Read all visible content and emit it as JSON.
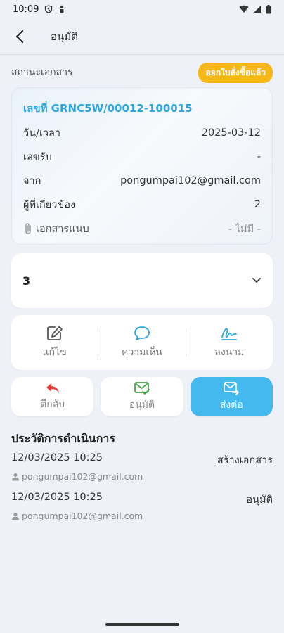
{
  "statusbar": {
    "time": "10:09"
  },
  "appbar": {
    "title": "อนุมัติ"
  },
  "status": {
    "label": "สถานะเอกสาร",
    "badge": "ออกใบสั่งซื้อแล้ว",
    "badge_color": "#f6b814"
  },
  "document": {
    "number": "เลขที่ GRNC5W/00012-100015",
    "rows": [
      {
        "key": "วัน/เวลา",
        "value": "2025-03-12"
      },
      {
        "key": "เลขรับ",
        "value": "-"
      },
      {
        "key": "จาก",
        "value": "pongumpai102@gmail.com"
      },
      {
        "key": "ผู้ที่เกี่ยวข้อง",
        "value": "2"
      }
    ],
    "attachment": {
      "key": "เอกสารแนบ",
      "value": "- ไม่มี -"
    }
  },
  "selector": {
    "value": "3"
  },
  "actions": [
    {
      "label": "แก้ไข",
      "icon": "edit-icon"
    },
    {
      "label": "ความเห็น",
      "icon": "comment-icon"
    },
    {
      "label": "ลงนาม",
      "icon": "signature-icon"
    }
  ],
  "buttons": {
    "reject": {
      "label": "ตีกลับ",
      "icon": "reply-icon",
      "color": "#e53935"
    },
    "approve": {
      "label": "อนุมัติ",
      "icon": "mail-check-icon",
      "color": "#43a047"
    },
    "forward": {
      "label": "ส่งต่อ",
      "icon": "mail-forward-icon",
      "color": "#43b9ee"
    }
  },
  "history": {
    "title": "ประวัติการดำเนินการ",
    "items": [
      {
        "datetime": "12/03/2025 10:25",
        "action": "สร้างเอกสาร",
        "user": "pongumpai102@gmail.com"
      },
      {
        "datetime": "12/03/2025 10:25",
        "action": "อนุมัติ",
        "user": "pongumpai102@gmail.com"
      }
    ]
  }
}
